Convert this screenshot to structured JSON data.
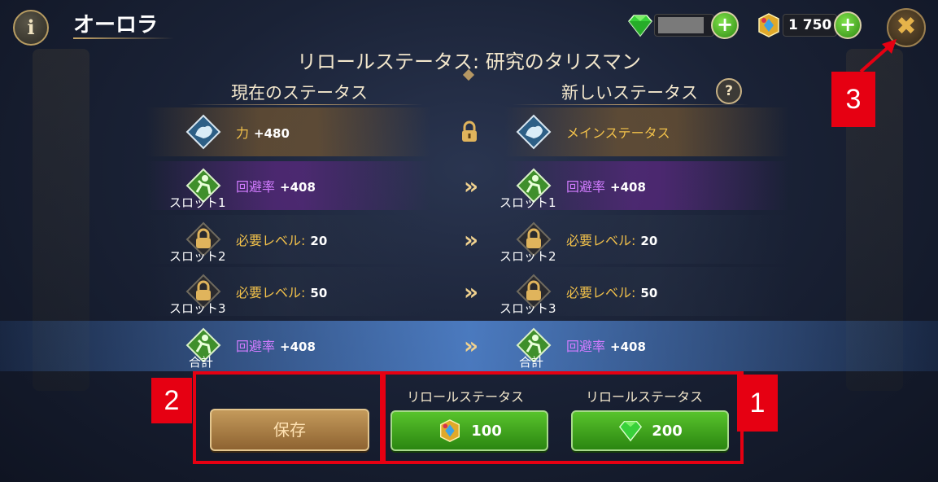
{
  "header": {
    "info_icon": "info-icon",
    "info_glyph": "i",
    "title": "オーロラ",
    "gems": {
      "icon": "green-gem-icon",
      "value": "",
      "plus_glyph": "+"
    },
    "crystals": {
      "icon": "gold-crystal-icon",
      "value": "1 750",
      "plus_glyph": "+"
    },
    "close_icon": "close-icon",
    "close_glyph": "✖"
  },
  "page_title": "リロールステータス: 研究のタリスマン",
  "columns": {
    "current": "現在のステータス",
    "new": "新しいステータス",
    "help_glyph": "?"
  },
  "rows": [
    {
      "current": {
        "name": "力",
        "value": "+480",
        "icon": "strength-icon",
        "slot": ""
      },
      "middle_icon": "lock-icon",
      "new": {
        "name": "メインステータス",
        "value": "",
        "icon": "strength-icon",
        "slot": ""
      }
    },
    {
      "current": {
        "name": "回避率",
        "value": "+408",
        "icon": "dodge-icon",
        "slot": "スロット1"
      },
      "middle_icon": "double-arrow-icon",
      "arrow_glyph": "»",
      "new": {
        "name": "回避率",
        "value": "+408",
        "icon": "dodge-icon",
        "slot": "スロット1"
      }
    },
    {
      "current": {
        "name": "必要レベル:",
        "value": "20",
        "icon": "lock-icon",
        "slot": "スロット2"
      },
      "middle_icon": "double-arrow-icon",
      "arrow_glyph": "»",
      "new": {
        "name": "必要レベル:",
        "value": "20",
        "icon": "lock-icon",
        "slot": "スロット2"
      }
    },
    {
      "current": {
        "name": "必要レベル:",
        "value": "50",
        "icon": "lock-icon",
        "slot": "スロット3"
      },
      "middle_icon": "double-arrow-icon",
      "arrow_glyph": "»",
      "new": {
        "name": "必要レベル:",
        "value": "50",
        "icon": "lock-icon",
        "slot": "スロット3"
      }
    },
    {
      "current": {
        "name": "回避率",
        "value": "+408",
        "icon": "dodge-icon",
        "slot": "合計"
      },
      "middle_icon": "double-arrow-icon",
      "arrow_glyph": "»",
      "new": {
        "name": "回避率",
        "value": "+408",
        "icon": "dodge-icon",
        "slot": "合計"
      }
    }
  ],
  "actions": {
    "save_label": "保存",
    "reroll_crystal": {
      "label": "リロールステータス",
      "cost": "100",
      "icon": "gold-crystal-icon"
    },
    "reroll_gem": {
      "label": "リロールステータス",
      "cost": "200",
      "icon": "green-gem-icon"
    }
  },
  "annotations": {
    "one": "1",
    "two": "2",
    "three": "3"
  },
  "colors": {
    "annotation_red": "#e60012",
    "accent_gold": "#f2c14a",
    "dodge_purple": "#d27cff",
    "button_green": "#2b8611"
  }
}
